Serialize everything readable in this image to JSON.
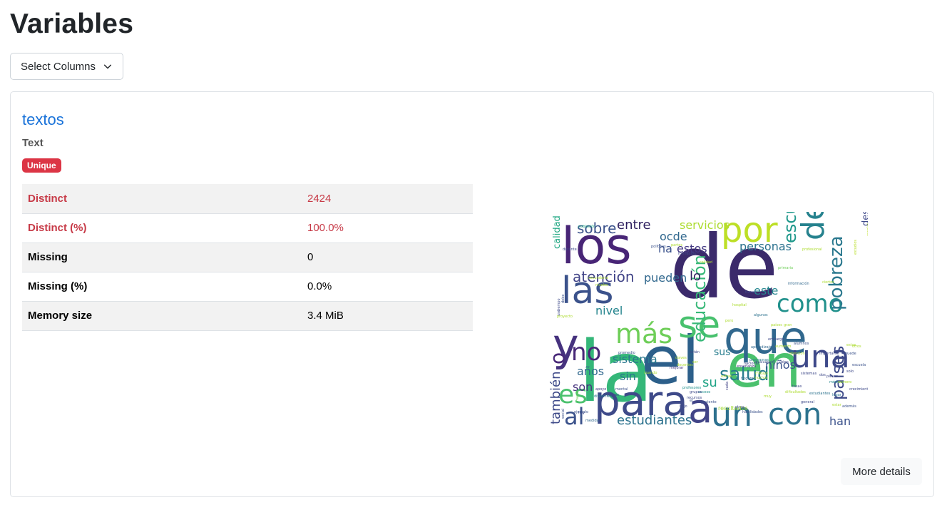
{
  "page": {
    "title": "Variables"
  },
  "select_columns": {
    "label": "Select Columns"
  },
  "variable": {
    "name": "textos",
    "type": "Text",
    "badge": "Unique",
    "stats": [
      {
        "label": "Distinct",
        "value": "2424",
        "alert": true
      },
      {
        "label": "Distinct (%)",
        "value": "100.0%",
        "alert": true
      },
      {
        "label": "Missing",
        "value": "0",
        "alert": false
      },
      {
        "label": "Missing (%)",
        "value": "0.0%",
        "alert": false
      },
      {
        "label": "Memory size",
        "value": "3.4 MiB",
        "alert": false
      }
    ],
    "more_details": "More details"
  },
  "wordcloud": {
    "words": [
      {
        "t": "de",
        "c": "#3b2a6b"
      },
      {
        "t": "la",
        "c": "#35b779"
      },
      {
        "t": "el",
        "c": "#2c5f8a"
      },
      {
        "t": "en",
        "c": "#4ac16d"
      },
      {
        "t": "los",
        "c": "#482576"
      },
      {
        "t": "y",
        "c": "#46327e"
      },
      {
        "t": "que",
        "c": "#31688e"
      },
      {
        "t": "para",
        "c": "#3e4a89"
      },
      {
        "t": "por",
        "c": "#bddf26"
      },
      {
        "t": "las",
        "c": "#3b528b"
      },
      {
        "t": "a",
        "c": "#414487"
      },
      {
        "t": "se",
        "c": "#48c16e"
      },
      {
        "t": "del",
        "c": "#26828e"
      },
      {
        "t": "una",
        "c": "#3e4989"
      },
      {
        "t": "un",
        "c": "#2d708e"
      },
      {
        "t": "con",
        "c": "#2c728e"
      },
      {
        "t": "es",
        "c": "#4ac16d"
      },
      {
        "t": "como",
        "c": "#21918c"
      },
      {
        "t": "más",
        "c": "#6ece58"
      },
      {
        "t": "no",
        "c": "#482878"
      },
      {
        "t": "al",
        "c": "#3b528b"
      },
      {
        "t": "salud",
        "c": "#287d8e"
      },
      {
        "t": "educación",
        "c": "#37b878"
      },
      {
        "t": "pobreza",
        "c": "#2a788e"
      },
      {
        "t": "escuelas",
        "c": "#1f988b"
      },
      {
        "t": "países",
        "c": "#3e4a89"
      },
      {
        "t": "estudiantes",
        "c": "#2c728e"
      },
      {
        "t": "atención",
        "c": "#414487"
      },
      {
        "t": "sobre",
        "c": "#3b528b"
      },
      {
        "t": "entre",
        "c": "#2d1e5e"
      },
      {
        "t": "servicios",
        "c": "#addc30"
      },
      {
        "t": "ocde",
        "c": "#31688e"
      },
      {
        "t": "estos",
        "c": "#443983"
      },
      {
        "t": "ha",
        "c": "#3b528b"
      },
      {
        "t": "personas",
        "c": "#2c728e"
      },
      {
        "t": "desarrollo",
        "c": "#3e4989"
      },
      {
        "t": "calidad",
        "c": "#22a884"
      },
      {
        "t": "también",
        "c": "#3e4a89"
      },
      {
        "t": "o",
        "c": "#482878"
      },
      {
        "t": "años",
        "c": "#31688e"
      },
      {
        "t": "son",
        "c": "#46327e"
      },
      {
        "t": "sistema",
        "c": "#2a788e"
      },
      {
        "t": "sin",
        "c": "#2a788e"
      },
      {
        "t": "niños",
        "c": "#3b528b"
      },
      {
        "t": "su",
        "c": "#20a386"
      },
      {
        "t": "sus",
        "c": "#287d8e"
      },
      {
        "t": "pueden",
        "c": "#31688e"
      },
      {
        "t": "lo",
        "c": "#2d1e5e"
      },
      {
        "t": "este",
        "c": "#25858e"
      },
      {
        "t": "nivel",
        "c": "#25858e"
      },
      {
        "t": "han",
        "c": "#3b528b"
      },
      {
        "t": "resultados",
        "c": "#a5db36"
      },
      {
        "t": "formación",
        "c": "#3e4989"
      },
      {
        "t": "primaria",
        "c": "#6ece58"
      },
      {
        "t": "información",
        "c": "#31688e"
      },
      {
        "t": "población",
        "c": "#22a884"
      },
      {
        "t": "médicos",
        "c": "#25858e"
      },
      {
        "t": "programas",
        "c": "#2a788e"
      },
      {
        "t": "evaluación",
        "c": "#3b528b"
      },
      {
        "t": "enseñanza",
        "c": "#46327e"
      },
      {
        "t": "hogares",
        "c": "#31688e"
      },
      {
        "t": "docentes",
        "c": "#addc30"
      },
      {
        "t": "mejorar",
        "c": "#443983"
      },
      {
        "t": "profesores",
        "c": "#21918c"
      },
      {
        "t": "acceso",
        "c": "#21918c"
      },
      {
        "t": "lugar",
        "c": "#2c728e"
      },
      {
        "t": "general",
        "c": "#3e4989"
      },
      {
        "t": "además",
        "c": "#3b528b"
      },
      {
        "t": "sistemas",
        "c": "#3e4989"
      },
      {
        "t": "número",
        "c": "#addc30"
      },
      {
        "t": "estudios",
        "c": "#b8de29"
      },
      {
        "t": "escolar",
        "c": "#bddf26"
      },
      {
        "t": "políticas",
        "c": "#3b528b"
      },
      {
        "t": "tiempo",
        "c": "#3e4989"
      },
      {
        "t": "mayor",
        "c": "#6ece58"
      },
      {
        "t": "pobres",
        "c": "#3e4989"
      },
      {
        "t": "hay",
        "c": "#3e4989"
      },
      {
        "t": "cada",
        "c": "#414487"
      },
      {
        "t": "social",
        "c": "#3b528b"
      },
      {
        "t": "tanto",
        "c": "#addc30"
      },
      {
        "t": "dos",
        "c": "#3e4989"
      },
      {
        "t": "bajo",
        "c": "#3e4989"
      },
      {
        "t": "tasas",
        "c": "#3e4989"
      },
      {
        "t": "otras",
        "c": "#3e4989"
      },
      {
        "t": "ejemplo",
        "c": "#3b528b"
      },
      {
        "t": "desde",
        "c": "#2c728e"
      },
      {
        "t": "medida",
        "c": "#31688e"
      },
      {
        "t": "apoyo",
        "c": "#443983"
      },
      {
        "t": "embargo",
        "c": "#3e4989"
      },
      {
        "t": "puede",
        "c": "#3b528b"
      },
      {
        "t": "solo",
        "c": "#3e4989"
      },
      {
        "t": "nacional",
        "c": "#3e4989"
      },
      {
        "t": "paciente",
        "c": "#3b528b"
      },
      {
        "t": "aprendizaje",
        "c": "#31688e"
      },
      {
        "t": "estas",
        "c": "#addc30"
      },
      {
        "t": "bien",
        "c": "#3e4989"
      },
      {
        "t": "gran",
        "c": "#addc30"
      },
      {
        "t": "trabajo",
        "c": "#addc30"
      },
      {
        "t": "grupos",
        "c": "#3e4989"
      },
      {
        "t": "mental",
        "c": "#3b528b"
      },
      {
        "t": "secundaria",
        "c": "#addc30"
      },
      {
        "t": "diferentes",
        "c": "#2c728e"
      },
      {
        "t": "recursos",
        "c": "#3e4989"
      },
      {
        "t": "importante",
        "c": "#3e4989"
      },
      {
        "t": "uso",
        "c": "#3e4989"
      },
      {
        "t": "alumnos",
        "c": "#3b528b"
      },
      {
        "t": "calidad",
        "c": "#addc30"
      },
      {
        "t": "proyecto",
        "c": "#addc30"
      },
      {
        "t": "cuando",
        "c": "#addc30"
      },
      {
        "t": "algunos",
        "c": "#2c728e"
      },
      {
        "t": "durante",
        "c": "#3e4989"
      },
      {
        "t": "niveles",
        "c": "#addc30"
      },
      {
        "t": "habilidades",
        "c": "#3b528b"
      },
      {
        "t": "promedio",
        "c": "#3b528b"
      },
      {
        "t": "claves",
        "c": "#addc30"
      },
      {
        "t": "debe",
        "c": "#3b528b"
      },
      {
        "t": "et",
        "c": "#3b528b"
      },
      {
        "t": "países",
        "c": "#addc30"
      },
      {
        "t": "pero",
        "c": "#addc30"
      },
      {
        "t": "están",
        "c": "#3e4989"
      },
      {
        "t": "tienen",
        "c": "#3e4989"
      },
      {
        "t": "ser",
        "c": "#addc30"
      },
      {
        "t": "ciertos",
        "c": "#addc30"
      },
      {
        "t": "atención",
        "c": "#addc30"
      },
      {
        "t": "partes",
        "c": "#addc30"
      },
      {
        "t": "aumento",
        "c": "#addc30"
      },
      {
        "t": "otros",
        "c": "#addc30"
      },
      {
        "t": "muchos",
        "c": "#addc30"
      },
      {
        "t": "estudiantes",
        "c": "#2c728e"
      },
      {
        "t": "crecimiento",
        "c": "#3e4989"
      },
      {
        "t": "profesional",
        "c": "#addc30"
      },
      {
        "t": "escuela",
        "c": "#3b528b"
      },
      {
        "t": "extrae",
        "c": "#addc30"
      },
      {
        "t": "estar",
        "c": "#addc30"
      },
      {
        "t": "países",
        "c": "#3e4989"
      },
      {
        "t": "dificultades",
        "c": "#addc30"
      },
      {
        "t": "muy",
        "c": "#addc30"
      },
      {
        "t": "hospital",
        "c": "#addc30"
      }
    ]
  }
}
